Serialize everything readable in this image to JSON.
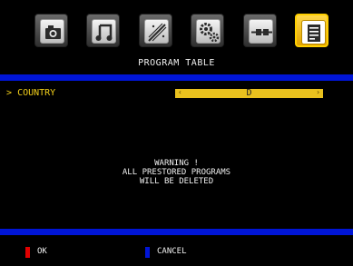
{
  "menu": {
    "icons": [
      {
        "name": "picture-icon",
        "active": false
      },
      {
        "name": "sound-icon",
        "active": false
      },
      {
        "name": "setup-icon",
        "active": false
      },
      {
        "name": "settings-icon",
        "active": false
      },
      {
        "name": "source-icon",
        "active": false
      },
      {
        "name": "program-table-icon",
        "active": true
      }
    ],
    "title": "PROGRAM TABLE"
  },
  "country_row": {
    "cursor": ">",
    "label": "COUNTRY",
    "left_arrow": "‹",
    "value": "D",
    "right_arrow": "›"
  },
  "warning": {
    "line1": "WARNING !",
    "line2": "ALL PRESTORED PROGRAMS",
    "line3": "WILL BE DELETED"
  },
  "footer": {
    "ok_label": "OK",
    "ok_color": "#e00000",
    "cancel_label": "CANCEL",
    "cancel_color": "#0015d6"
  },
  "colors": {
    "accent_bar": "#0015d6",
    "highlight": "#f2cf1a"
  }
}
